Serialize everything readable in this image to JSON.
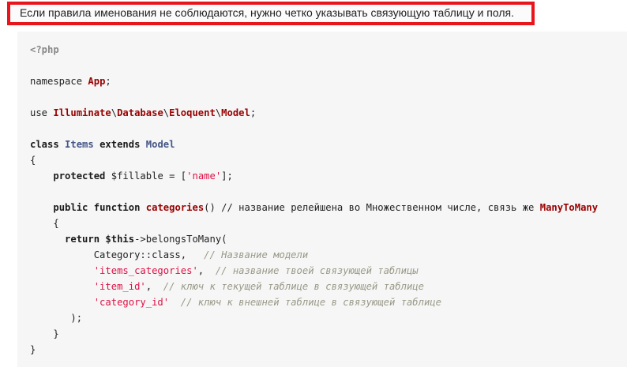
{
  "note": {
    "text": "Если правила именования не соблюдаются, нужно четко указывать связующую таблицу и поля."
  },
  "code": {
    "lines": [
      {
        "parts": [
          {
            "t": "<?php",
            "c": "tag"
          }
        ]
      },
      {
        "parts": [
          {
            "t": "namespace",
            "c": "pl"
          },
          {
            "t": " ",
            "c": "pl"
          },
          {
            "t": "App",
            "c": "cls"
          },
          {
            "t": ";",
            "c": "pl"
          }
        ]
      },
      {
        "parts": [
          {
            "t": "use",
            "c": "pl"
          },
          {
            "t": " ",
            "c": "pl"
          },
          {
            "t": "Illuminate",
            "c": "cls"
          },
          {
            "t": "\\",
            "c": "pl"
          },
          {
            "t": "Database",
            "c": "cls"
          },
          {
            "t": "\\",
            "c": "pl"
          },
          {
            "t": "Eloquent",
            "c": "cls"
          },
          {
            "t": "\\",
            "c": "pl"
          },
          {
            "t": "Model",
            "c": "cls"
          },
          {
            "t": ";",
            "c": "pl"
          }
        ]
      },
      {
        "parts": [
          {
            "t": "class",
            "c": "kw"
          },
          {
            "t": " ",
            "c": "pl"
          },
          {
            "t": "Items",
            "c": "type"
          },
          {
            "t": " ",
            "c": "pl"
          },
          {
            "t": "extends",
            "c": "kw"
          },
          {
            "t": " ",
            "c": "pl"
          },
          {
            "t": "Model",
            "c": "type"
          }
        ]
      },
      {
        "parts": [
          {
            "t": "{",
            "c": "pl"
          }
        ]
      },
      {
        "parts": [
          {
            "t": "    ",
            "c": "pl"
          },
          {
            "t": "protected",
            "c": "kw"
          },
          {
            "t": " $fillable = [",
            "c": "pl"
          },
          {
            "t": "'name'",
            "c": "str"
          },
          {
            "t": "];",
            "c": "pl"
          }
        ]
      },
      {
        "parts": [
          {
            "t": "    ",
            "c": "pl"
          },
          {
            "t": "public",
            "c": "kw"
          },
          {
            "t": " ",
            "c": "pl"
          },
          {
            "t": "function",
            "c": "kw"
          },
          {
            "t": " ",
            "c": "pl"
          },
          {
            "t": "categories",
            "c": "fn"
          },
          {
            "t": "() // название релейшена во Множественном числе, связь же ",
            "c": "pl"
          },
          {
            "t": "ManyToMany",
            "c": "fn"
          }
        ]
      },
      {
        "parts": [
          {
            "t": "    {",
            "c": "pl"
          }
        ]
      },
      {
        "parts": [
          {
            "t": "      ",
            "c": "pl"
          },
          {
            "t": "return",
            "c": "kw"
          },
          {
            "t": " ",
            "c": "pl"
          },
          {
            "t": "$this",
            "c": "kw"
          },
          {
            "t": "->belongsToMany(",
            "c": "pl"
          }
        ]
      },
      {
        "parts": [
          {
            "t": "           Category::class,   ",
            "c": "pl"
          },
          {
            "t": "// Название модели",
            "c": "cmt"
          }
        ]
      },
      {
        "parts": [
          {
            "t": "           ",
            "c": "pl"
          },
          {
            "t": "'items_categories'",
            "c": "str"
          },
          {
            "t": ",  ",
            "c": "pl"
          },
          {
            "t": "// название твоей связующей таблицы",
            "c": "cmt"
          }
        ]
      },
      {
        "parts": [
          {
            "t": "           ",
            "c": "pl"
          },
          {
            "t": "'item_id'",
            "c": "str"
          },
          {
            "t": ",  ",
            "c": "pl"
          },
          {
            "t": "// ключ к текущей таблице в связующей таблице",
            "c": "cmt"
          }
        ]
      },
      {
        "parts": [
          {
            "t": "           ",
            "c": "pl"
          },
          {
            "t": "'category_id'",
            "c": "str"
          },
          {
            "t": "  ",
            "c": "pl"
          },
          {
            "t": "// ключ к внешней таблице в связующей таблице",
            "c": "cmt"
          }
        ]
      },
      {
        "parts": [
          {
            "t": "       );",
            "c": "pl"
          }
        ]
      },
      {
        "parts": [
          {
            "t": "    }",
            "c": "pl"
          }
        ]
      },
      {
        "parts": [
          {
            "t": "}",
            "c": "pl"
          }
        ]
      }
    ]
  }
}
